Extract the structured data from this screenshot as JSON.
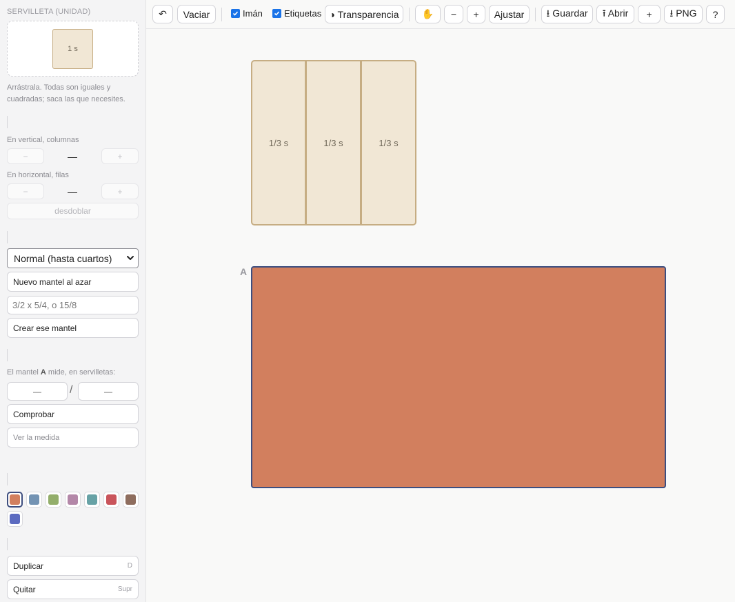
{
  "sidebar": {
    "napkin_title": "SERVILLETA (UNIDAD)",
    "napkin_label": "1 s",
    "help_text": "Arrástrala. Todas son iguales y cuadradas; saca las que necesites.",
    "columns_label": "En vertical, columnas",
    "columns_minus": "−",
    "columns_value": "—",
    "columns_plus": "+",
    "rows_label": "En horizontal, filas",
    "rows_minus": "−",
    "rows_value": "—",
    "rows_plus": "+",
    "unfold_label": "desdoblar",
    "difficulty_selected": "Normal (hasta cuartos)",
    "random_label": "Nuevo mantel al azar",
    "custom_placeholder": "3/2 x 5/4, o 15/8",
    "create_label": "Crear ese mantel",
    "measure_prompt_pre": "El mantel ",
    "measure_prompt_letter": "A",
    "measure_prompt_post": " mide, en servilletas:",
    "measure_a": "—",
    "measure_slash": "/",
    "measure_b": "—",
    "check_label": "Comprobar",
    "see_measure_label": "Ver la medida",
    "colors": [
      "#d27f5e",
      "#7393b3",
      "#93ae6b",
      "#b387a8",
      "#67a2a6",
      "#c9545b",
      "#8e6d5e",
      "#5c6bc0"
    ],
    "selected_color": "#d27f5e",
    "duplicate_label": "Duplicar",
    "duplicate_key": "D",
    "remove_label": "Quitar",
    "remove_key": "Supr"
  },
  "toolbar": {
    "undo_icon": "undo-icon",
    "undo_glyph": "↶",
    "clear_label": "Vaciar",
    "magnet_label": "Imán",
    "magnet_checked": true,
    "labels_label": "Etiquetas",
    "labels_checked": true,
    "transparency_label": "◑ Transparencia",
    "pan_icon": "hand-icon",
    "pan_glyph": "✋",
    "zoom_out": "−",
    "zoom_in": "+",
    "fit_label": "Ajustar",
    "save_label": "⭳ Guardar",
    "open_label": "⭱ Abrir",
    "new_label": "+",
    "png_label": "⭳ PNG",
    "help_label": "?"
  },
  "canvas": {
    "strips": [
      {
        "label": "1/3 s"
      },
      {
        "label": "1/3 s"
      },
      {
        "label": "1/3 s"
      }
    ],
    "tablecloth_label": "A",
    "tablecloth_color": "#d27f5e",
    "tablecloth_border": "#3c4e80",
    "strip_fill": "#f1e7d5",
    "strip_border": "#c6ad83"
  }
}
